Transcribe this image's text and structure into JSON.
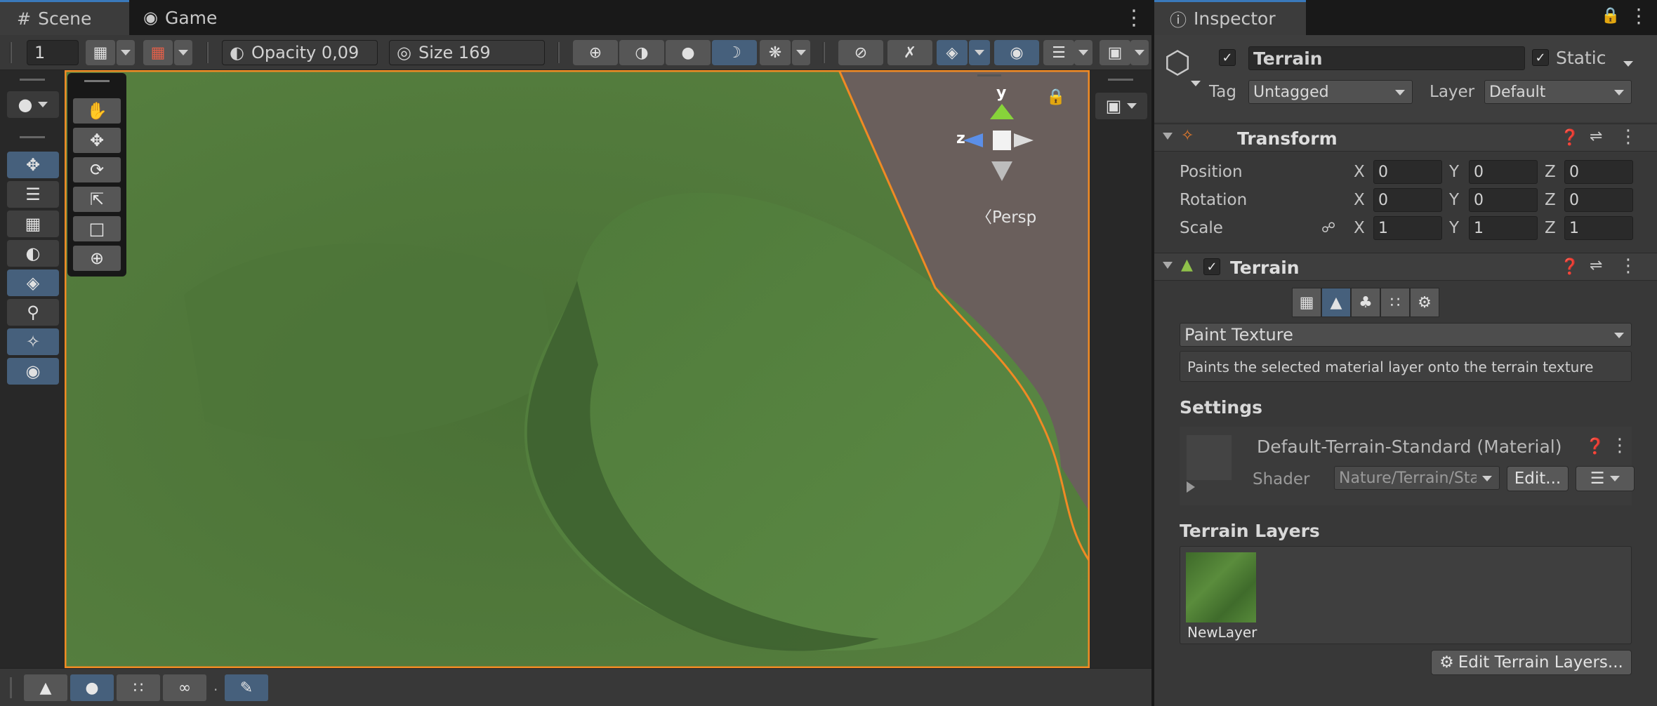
{
  "scene_panel": {
    "tabs": [
      {
        "label": "Scene",
        "icon": "grid-icon"
      },
      {
        "label": "Game",
        "icon": "gamepad-icon"
      }
    ],
    "toolbar": {
      "layer_value": "1",
      "opacity_label": "Opacity 0,09",
      "size_label": "Size 169"
    },
    "gizmo": {
      "y_label": "y",
      "z_label": "z",
      "persp_label": "〈Persp"
    }
  },
  "inspector": {
    "tab_label": "Inspector",
    "object": {
      "name": "Terrain",
      "static_label": "Static",
      "tag_label": "Tag",
      "tag_value": "Untagged",
      "layer_label": "Layer",
      "layer_value": "Default"
    },
    "transform": {
      "title": "Transform",
      "rows": [
        {
          "label": "Position",
          "x": "0",
          "y": "0",
          "z": "0"
        },
        {
          "label": "Rotation",
          "x": "0",
          "y": "0",
          "z": "0"
        },
        {
          "label": "Scale",
          "x": "1",
          "y": "1",
          "z": "1"
        }
      ],
      "axis": {
        "x": "X",
        "y": "Y",
        "z": "Z"
      }
    },
    "terrain": {
      "title": "Terrain",
      "mode": "Paint Texture",
      "description": "Paints the selected material layer onto the terrain texture",
      "settings_label": "Settings",
      "material_name": "Default-Terrain-Standard (Material)",
      "shader_label": "Shader",
      "shader_value": "Nature/Terrain/Standard",
      "edit_label": "Edit...",
      "layers_title": "Terrain Layers",
      "layer_name": "NewLayer",
      "edit_layers_label": "Edit Terrain Layers..."
    }
  },
  "colors": {
    "accent": "#46607c",
    "selection_outline": "#f08a24",
    "terrain": "#4f7a3a"
  }
}
